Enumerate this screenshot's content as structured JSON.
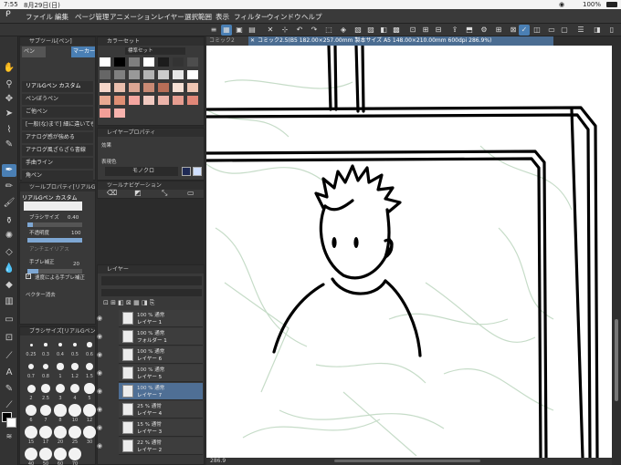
{
  "status": {
    "time": "7:55",
    "date": "8月29日(日)",
    "battery": "100%"
  },
  "menu": [
    "ファイル",
    "編集",
    "ページ管理",
    "アニメーション",
    "レイヤー",
    "選択範囲",
    "表示",
    "フィルター",
    "ウィンドウ",
    "ヘルプ"
  ],
  "tabs": {
    "inactive": "コミック2",
    "active": "コミック2.5(B5 182.00×257.00mm 製本サイズ A5 148.00×210.00mm 600dpi 286.9%)"
  },
  "subtool": {
    "title": "サブツール[ペン]",
    "tabs": [
      "ペン",
      "マーカー"
    ],
    "items": [
      "リアルGペン カスタム",
      "ペンぼうペン",
      "ご他ペン",
      "[一般(な)まで] 細に違いても",
      "アナログ感が強める",
      "アナログ風ざらざら書線",
      "手曲ライン",
      "角ペン",
      "なめらか線描ペン カスタム"
    ]
  },
  "colorset": {
    "title": "カラーセット",
    "preset": "標準セット"
  },
  "toolprop": {
    "title": "ツールプロパティ[リアルGペン",
    "brush_name": "リアルGペン カスタム",
    "brush_size_label": "ブラシサイズ",
    "brush_size_value": "0.40",
    "opacity_label": "不透明度",
    "opacity_value": "100",
    "antialias_label": "アンチエイリアス",
    "correction_label": "手ブレ補正",
    "correction_value": "20",
    "speed_correction_label": "速度による手ブレ補正",
    "vector_label": "ベクター消去"
  },
  "layerprop": {
    "title": "レイヤープロパティ",
    "effect_label": "効果",
    "color_label": "表現色",
    "color_value": "モノクロ"
  },
  "toolnav": {
    "title": "ツールナビゲーション"
  },
  "brushsize": {
    "title": "ブラシサイズ[リアルGペン",
    "labels": [
      "0.25",
      "0.3",
      "0.4",
      "0.5",
      "0.6",
      "0.7",
      "0.8",
      "1",
      "1.2",
      "1.5",
      "2",
      "2.5",
      "3",
      "4",
      "5",
      "6",
      "7",
      "8",
      "10",
      "12",
      "15",
      "17",
      "20",
      "25",
      "30",
      "40",
      "50",
      "60",
      "70"
    ]
  },
  "layers": {
    "title": "レイヤー",
    "items": [
      {
        "pct": "100 % 通常",
        "name": "レイヤー 1"
      },
      {
        "pct": "100 % 通常",
        "name": "フォルダー 1"
      },
      {
        "pct": "100 % 通常",
        "name": "レイヤー 6"
      },
      {
        "pct": "100 % 通常",
        "name": "レイヤー 5"
      },
      {
        "pct": "100 % 通常",
        "name": "レイヤー 7"
      },
      {
        "pct": "25 % 通常",
        "name": "レイヤー 4"
      },
      {
        "pct": "15 % 通常",
        "name": "レイヤー 3"
      },
      {
        "pct": "22 % 通常",
        "name": "レイヤー 2"
      }
    ]
  },
  "canvas": {
    "zoom": "286.9"
  },
  "colors": {
    "accent": "#4a7fb4",
    "sketch": "#c6dcc8",
    "ink": "#000000"
  }
}
